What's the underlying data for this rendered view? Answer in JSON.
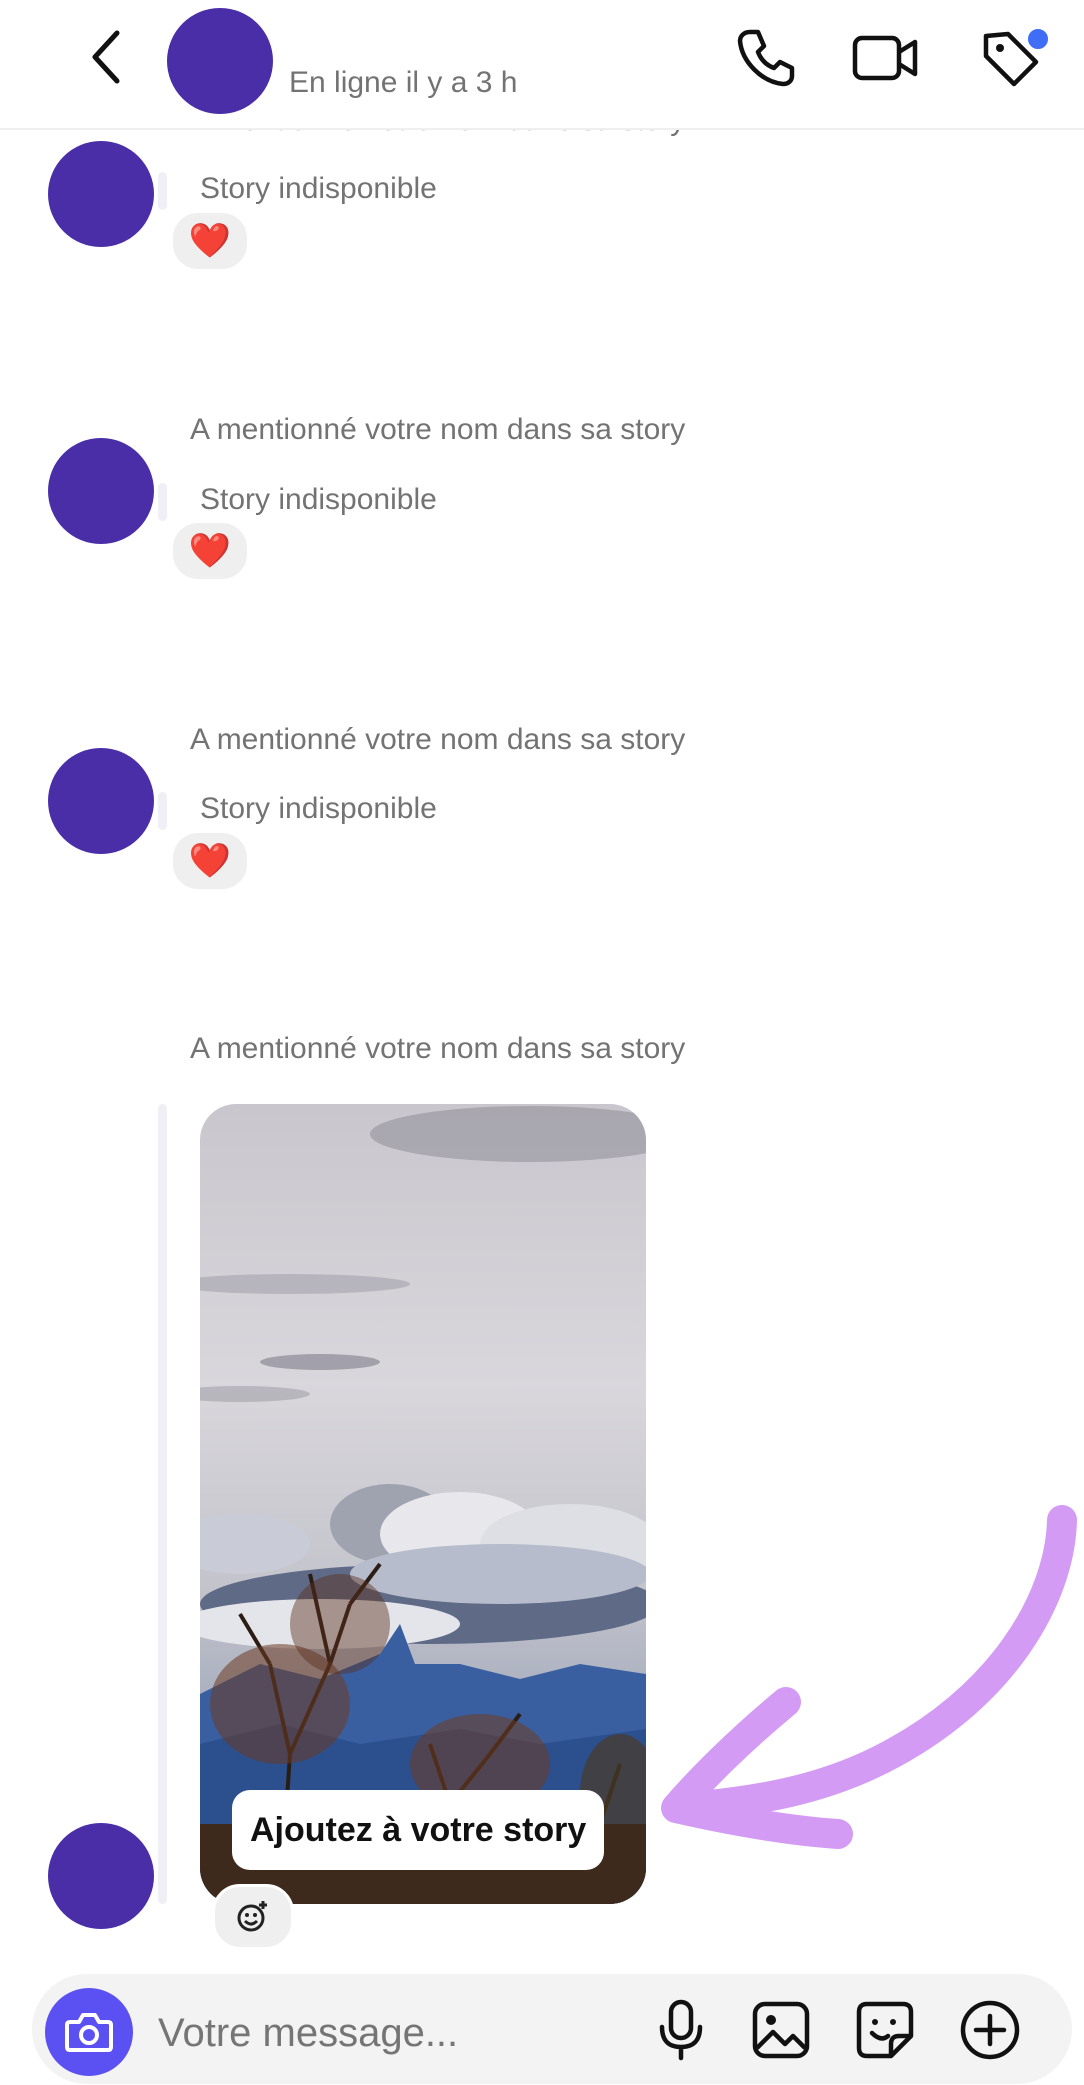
{
  "header": {
    "status": "En ligne il y a 3 h"
  },
  "colors": {
    "avatar": "#4a2ea8",
    "accent": "#5b51f3",
    "badge": "#3f6df6",
    "arrow": "#d49bf5",
    "muted_text": "#737373"
  },
  "messages": [
    {
      "mention": "A mentionné votre nom dans sa story",
      "story": "Story indisponible",
      "reaction": "❤️"
    },
    {
      "mention": "A mentionné votre nom dans sa story",
      "story": "Story indisponible",
      "reaction": "❤️"
    },
    {
      "mention": "A mentionné votre nom dans sa story",
      "story": "Story indisponible",
      "reaction": "❤️"
    },
    {
      "mention": "A mentionné votre nom dans sa story",
      "story_label": "Ajoutez à votre story"
    }
  ],
  "composer": {
    "placeholder": "Votre message..."
  },
  "icons": [
    "back-arrow-icon",
    "phone-icon",
    "video-icon",
    "tag-icon",
    "camera-icon",
    "microphone-icon",
    "image-icon",
    "sticker-icon",
    "plus-icon",
    "add-reaction-icon"
  ]
}
